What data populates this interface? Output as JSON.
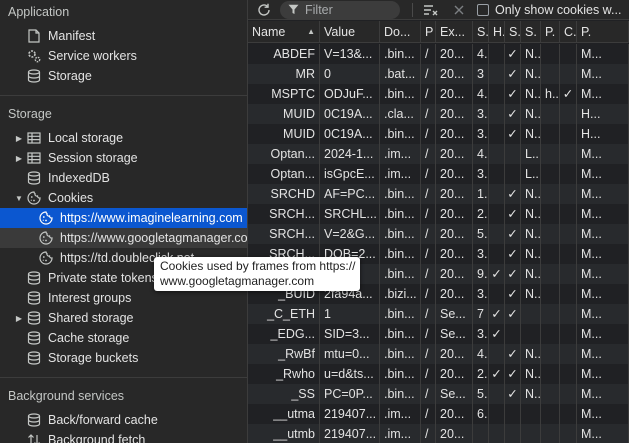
{
  "sidebar": {
    "application": {
      "title": "Application",
      "items": [
        {
          "label": "Manifest",
          "icon": "document-icon"
        },
        {
          "label": "Service workers",
          "icon": "gears-icon"
        },
        {
          "label": "Storage",
          "icon": "database-icon"
        }
      ]
    },
    "storage": {
      "title": "Storage",
      "items": [
        {
          "label": "Local storage",
          "icon": "grid-icon",
          "expandable": true
        },
        {
          "label": "Session storage",
          "icon": "grid-icon",
          "expandable": true
        },
        {
          "label": "IndexedDB",
          "icon": "database-icon"
        },
        {
          "label": "Cookies",
          "icon": "cookie-icon",
          "expanded": true
        },
        {
          "label": "https://www.imaginelearning.com",
          "icon": "cookie-icon",
          "selected": true
        },
        {
          "label": "https://www.googletagmanager.com",
          "icon": "cookie-icon",
          "hovered": true
        },
        {
          "label": "https://td.doubleclick.net",
          "icon": "cookie-icon"
        },
        {
          "label": "Private state tokens",
          "icon": "database-icon"
        },
        {
          "label": "Interest groups",
          "icon": "database-icon"
        },
        {
          "label": "Shared storage",
          "icon": "database-icon",
          "expandable": true
        },
        {
          "label": "Cache storage",
          "icon": "database-icon"
        },
        {
          "label": "Storage buckets",
          "icon": "database-icon"
        }
      ]
    },
    "background": {
      "title": "Background services",
      "items": [
        {
          "label": "Back/forward cache",
          "icon": "database-icon"
        },
        {
          "label": "Background fetch",
          "icon": "arrows-icon"
        }
      ]
    }
  },
  "toolbar": {
    "filter_placeholder": "Filter",
    "only_show_label": "Only show cookies w..."
  },
  "table": {
    "columns": [
      "Name",
      "Value",
      "Do...",
      "P",
      "Ex...",
      "S.",
      "H.",
      "S.",
      "S.",
      "P.",
      "C.",
      "P."
    ],
    "rows": [
      [
        "ABDEF",
        "V=13&...",
        ".bin...",
        "/",
        "20...",
        "4...",
        "",
        "✓",
        "N...",
        "",
        "",
        "M..."
      ],
      [
        "MR",
        "0",
        ".bat...",
        "/",
        "20...",
        "3",
        "",
        "✓",
        "N...",
        "",
        "",
        "M..."
      ],
      [
        "MSPTC",
        "ODJuF...",
        ".bin...",
        "/",
        "20...",
        "4...",
        "",
        "✓",
        "N...",
        "h...",
        "✓",
        "M..."
      ],
      [
        "MUID",
        "0C19A...",
        ".cla...",
        "/",
        "20...",
        "3...",
        "",
        "✓",
        "N...",
        "",
        "",
        "H..."
      ],
      [
        "MUID",
        "0C19A...",
        ".bin...",
        "/",
        "20...",
        "3...",
        "",
        "✓",
        "N...",
        "",
        "",
        "H..."
      ],
      [
        "Optan...",
        "2024-1...",
        ".im...",
        "/",
        "20...",
        "4...",
        "",
        "",
        "L...",
        "",
        "",
        "M..."
      ],
      [
        "Optan...",
        "isGpcE...",
        ".im...",
        "/",
        "20...",
        "3...",
        "",
        "",
        "L...",
        "",
        "",
        "M..."
      ],
      [
        "SRCHD",
        "AF=PC...",
        ".bin...",
        "/",
        "20...",
        "1...",
        "",
        "✓",
        "N...",
        "",
        "",
        "M..."
      ],
      [
        "SRCH...",
        "SRCHL...",
        ".bin...",
        "/",
        "20...",
        "2...",
        "",
        "✓",
        "N...",
        "",
        "",
        "M..."
      ],
      [
        "SRCH...",
        "V=2&G...",
        ".bin...",
        "/",
        "20...",
        "5...",
        "",
        "✓",
        "N...",
        "",
        "",
        "M..."
      ],
      [
        "SRCH...",
        "DOB=2...",
        ".bin...",
        "/",
        "20...",
        "3...",
        "",
        "✓",
        "N...",
        "",
        "",
        "M..."
      ],
      [
        "",
        "",
        ".bin...",
        "/",
        "20...",
        "9...",
        "✓",
        "✓",
        "N...",
        "",
        "",
        "M..."
      ],
      [
        "_BUID",
        "2fa94a...",
        ".bizi...",
        "/",
        "20...",
        "3...",
        "",
        "✓",
        "N...",
        "",
        "",
        "M..."
      ],
      [
        "_C_ETH",
        "1",
        ".bin...",
        "/",
        "Se...",
        "7",
        "✓",
        "✓",
        "",
        "",
        "",
        "M..."
      ],
      [
        "_EDG...",
        "SID=3...",
        ".bin...",
        "/",
        "Se...",
        "3...",
        "✓",
        "",
        "",
        "",
        "",
        "M..."
      ],
      [
        "_RwBf",
        "mtu=0...",
        ".bin...",
        "/",
        "20...",
        "4...",
        "",
        "✓",
        "N...",
        "",
        "",
        "M..."
      ],
      [
        "_Rwho",
        "u=d&ts...",
        ".bin...",
        "/",
        "20...",
        "2...",
        "✓",
        "✓",
        "N...",
        "",
        "",
        "M..."
      ],
      [
        "_SS",
        "PC=0P...",
        ".bin...",
        "/",
        "Se...",
        "5...",
        "",
        "✓",
        "N...",
        "",
        "",
        "M..."
      ],
      [
        "__utma",
        "219407...",
        ".im...",
        "/",
        "20...",
        "6...",
        "",
        "",
        "",
        "",
        "",
        "M..."
      ],
      [
        "__utmb",
        "219407...",
        ".im...",
        "/",
        "20...",
        "",
        "",
        "",
        "",
        "",
        "",
        "M..."
      ]
    ]
  },
  "tooltip": {
    "line1": "Cookies used by frames from https://",
    "line2": "www.googletagmanager.com"
  },
  "colors": {
    "selected_bg": "#0b57d0",
    "panel_bg": "#282828",
    "grid_bg": "#202124"
  }
}
